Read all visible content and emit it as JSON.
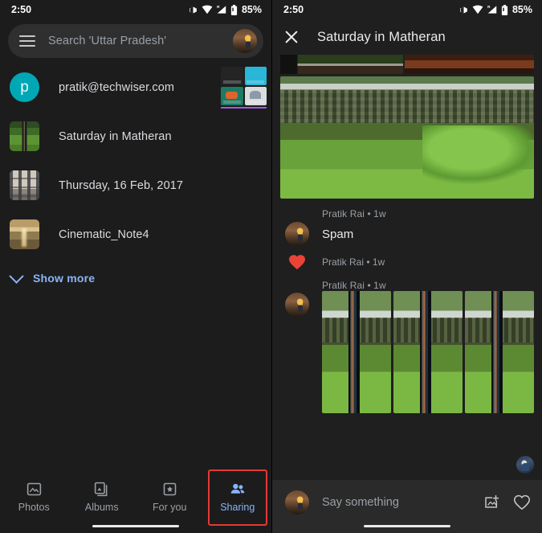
{
  "left": {
    "status": {
      "time": "2:50",
      "battery": "85%",
      "icons": [
        "vibrate-icon",
        "wifi-icon",
        "signal-icon",
        "battery-icon"
      ]
    },
    "search": {
      "placeholder": "Search 'Uttar Pradesh'",
      "menu_icon": "hamburger-icon",
      "avatar": "account-avatar"
    },
    "items": [
      {
        "label": "pratik@techwiser.com",
        "avatar_letter": "p",
        "type": "account"
      },
      {
        "label": "Saturday in Matheran",
        "type": "album"
      },
      {
        "label": "Thursday, 16 Feb, 2017",
        "type": "album"
      },
      {
        "label": "Cinematic_Note4",
        "type": "album"
      }
    ],
    "show_more": "Show more",
    "nav": [
      {
        "label": "Photos",
        "icon": "photos-icon",
        "active": false
      },
      {
        "label": "Albums",
        "icon": "albums-icon",
        "active": false
      },
      {
        "label": "For you",
        "icon": "for-you-icon",
        "active": false
      },
      {
        "label": "Sharing",
        "icon": "sharing-icon",
        "active": true
      }
    ]
  },
  "right": {
    "status": {
      "time": "2:50",
      "battery": "85%"
    },
    "appbar": {
      "title": "Saturday in Matheran",
      "close_icon": "close-icon"
    },
    "feed": [
      {
        "kind": "photo-meta",
        "meta": "Pratik Rai • 1w"
      },
      {
        "kind": "comment",
        "text": "Spam",
        "author": "Pratik Rai"
      },
      {
        "kind": "reaction",
        "meta": "Pratik Rai • 1w",
        "icon": "heart-filled-icon"
      },
      {
        "kind": "photo-group",
        "meta": "Pratik Rai • 1w",
        "count": 3
      }
    ],
    "composer": {
      "placeholder": "Say something",
      "add_photo_icon": "add-photo-icon",
      "like_icon": "heart-outline-icon",
      "avatar": "account-avatar"
    }
  },
  "colors": {
    "accent_blue": "#8ab4f8",
    "heart_red": "#ea4335",
    "avatar_teal": "#00a7b5",
    "highlight_red": "#e53935",
    "bg_dark": "#1f1f1f"
  }
}
